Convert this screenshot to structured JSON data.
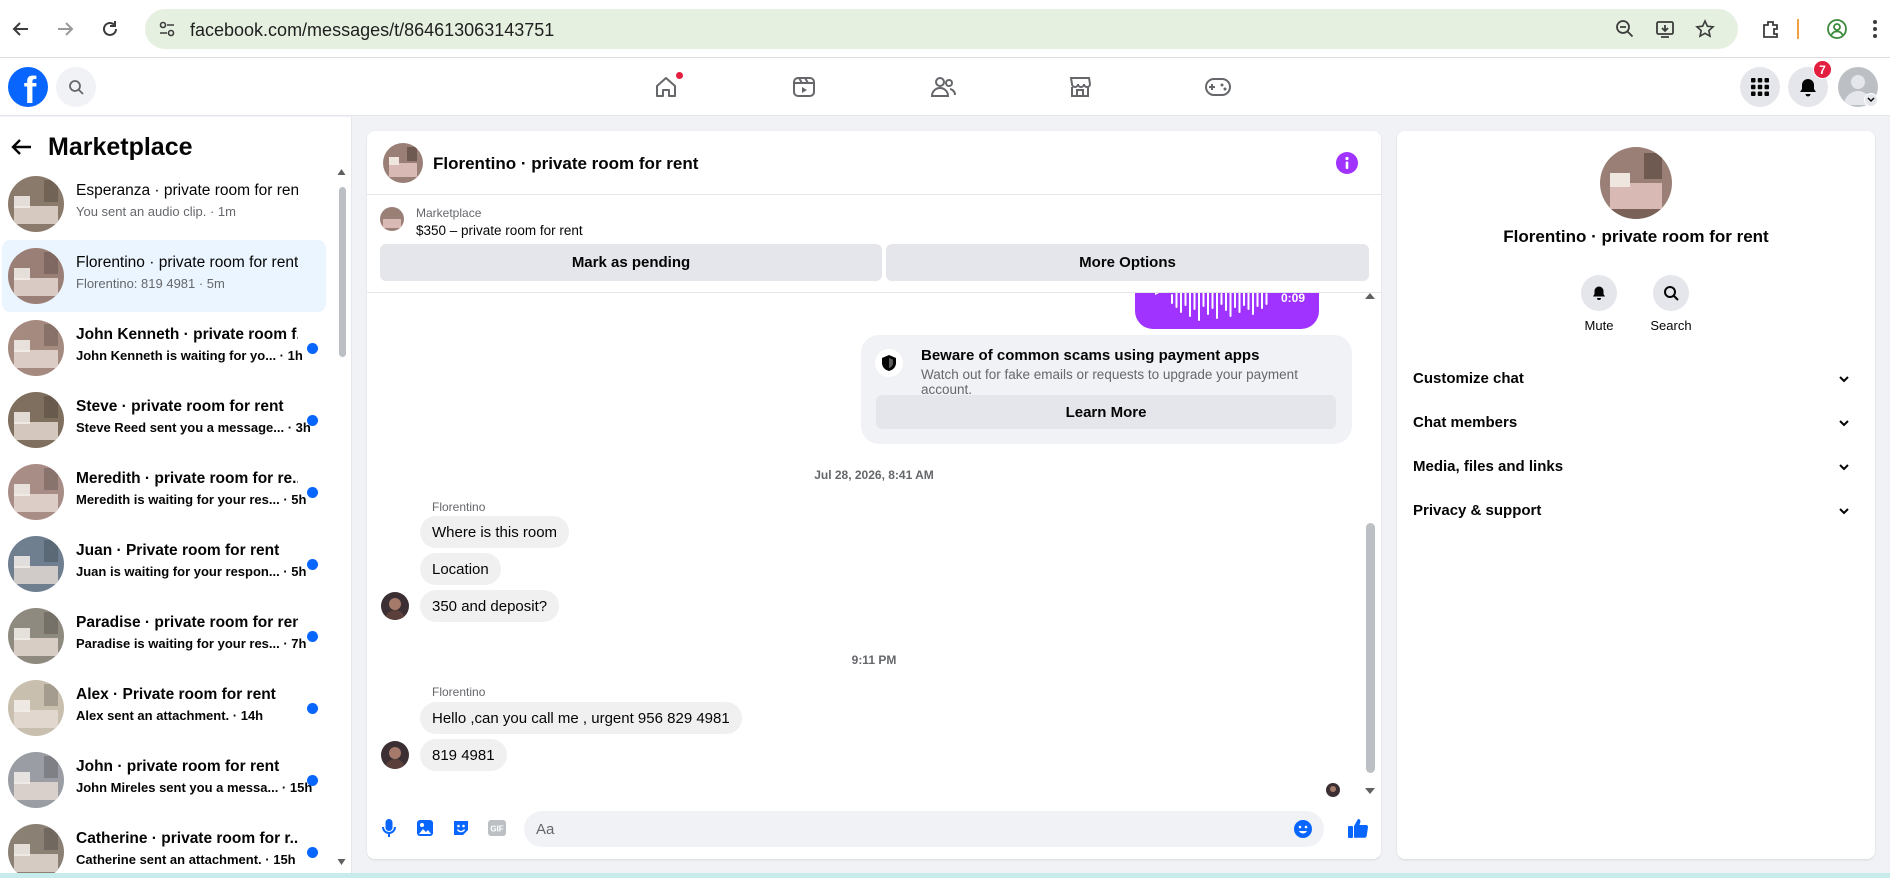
{
  "browser": {
    "url": "facebook.com/messages/t/864613063143751"
  },
  "nav": {
    "notifications_count": "7",
    "home_dot_color": "#e41e3f",
    "brand_color": "#0866ff"
  },
  "sidebar": {
    "title": "Marketplace",
    "conversations": [
      {
        "name": "Esperanza · private room for rent",
        "preview": "You sent an audio clip. · 1m",
        "unread": false,
        "active": false,
        "thumb": "#8a7a6b"
      },
      {
        "name": "Florentino · private room for rent",
        "preview": "Florentino: 819 4981 · 5m",
        "unread": false,
        "active": true,
        "thumb": "#9a7f77"
      },
      {
        "name": "John Kenneth · private room f...",
        "preview": "John Kenneth is waiting for yo... · 1h",
        "unread": true,
        "active": false,
        "thumb": "#a58a80"
      },
      {
        "name": "Steve · private room for rent",
        "preview": "Steve Reed sent you a message... · 3h",
        "unread": true,
        "active": false,
        "thumb": "#7f6f5e"
      },
      {
        "name": "Meredith · private room for re...",
        "preview": "Meredith is waiting for your res... · 5h",
        "unread": true,
        "active": false,
        "thumb": "#a88d86"
      },
      {
        "name": "Juan · Private room for rent",
        "preview": "Juan is waiting for your respon... · 5h",
        "unread": true,
        "active": false,
        "thumb": "#6f7f8f"
      },
      {
        "name": "Paradise · private room for rent",
        "preview": "Paradise is waiting for your res... · 7h",
        "unread": true,
        "active": false,
        "thumb": "#8f8a80"
      },
      {
        "name": "Alex · Private room for rent",
        "preview": "Alex sent an attachment. · 14h",
        "unread": true,
        "active": false,
        "thumb": "#c9bfae"
      },
      {
        "name": "John · private room for rent",
        "preview": "John Mireles sent you a messa... · 15h",
        "unread": true,
        "active": false,
        "thumb": "#9a9da3"
      },
      {
        "name": "Catherine · private room for r...",
        "preview": "Catherine sent an attachment. · 15h",
        "unread": true,
        "active": false,
        "thumb": "#8a8074"
      }
    ]
  },
  "chat": {
    "title": "Florentino · private room for rent",
    "marketplace_label": "Marketplace",
    "listing": "$350 – private room for rent",
    "mark_pending": "Mark as pending",
    "more_options": "More Options",
    "audio_duration": "0:09",
    "scam_title": "Beware of common scams using payment apps",
    "scam_text": "Watch out for fake emails or requests to upgrade your payment account.",
    "learn_more": "Learn More",
    "timestamp1": "Jul 28, 2026, 8:41 AM",
    "sender": "Florentino",
    "group1": [
      "Where is this room",
      "Location",
      "350 and deposit?"
    ],
    "timestamp2": "9:11 PM",
    "group2": [
      "Hello ,can you call me , urgent 956 829 4981",
      "819 4981"
    ],
    "composer_placeholder": "Aa",
    "accent_color": "#a033ff"
  },
  "details": {
    "name": "Florentino · private room for rent",
    "mute": "Mute",
    "search": "Search",
    "sections": [
      "Customize chat",
      "Chat members",
      "Media, files and links",
      "Privacy & support"
    ]
  }
}
